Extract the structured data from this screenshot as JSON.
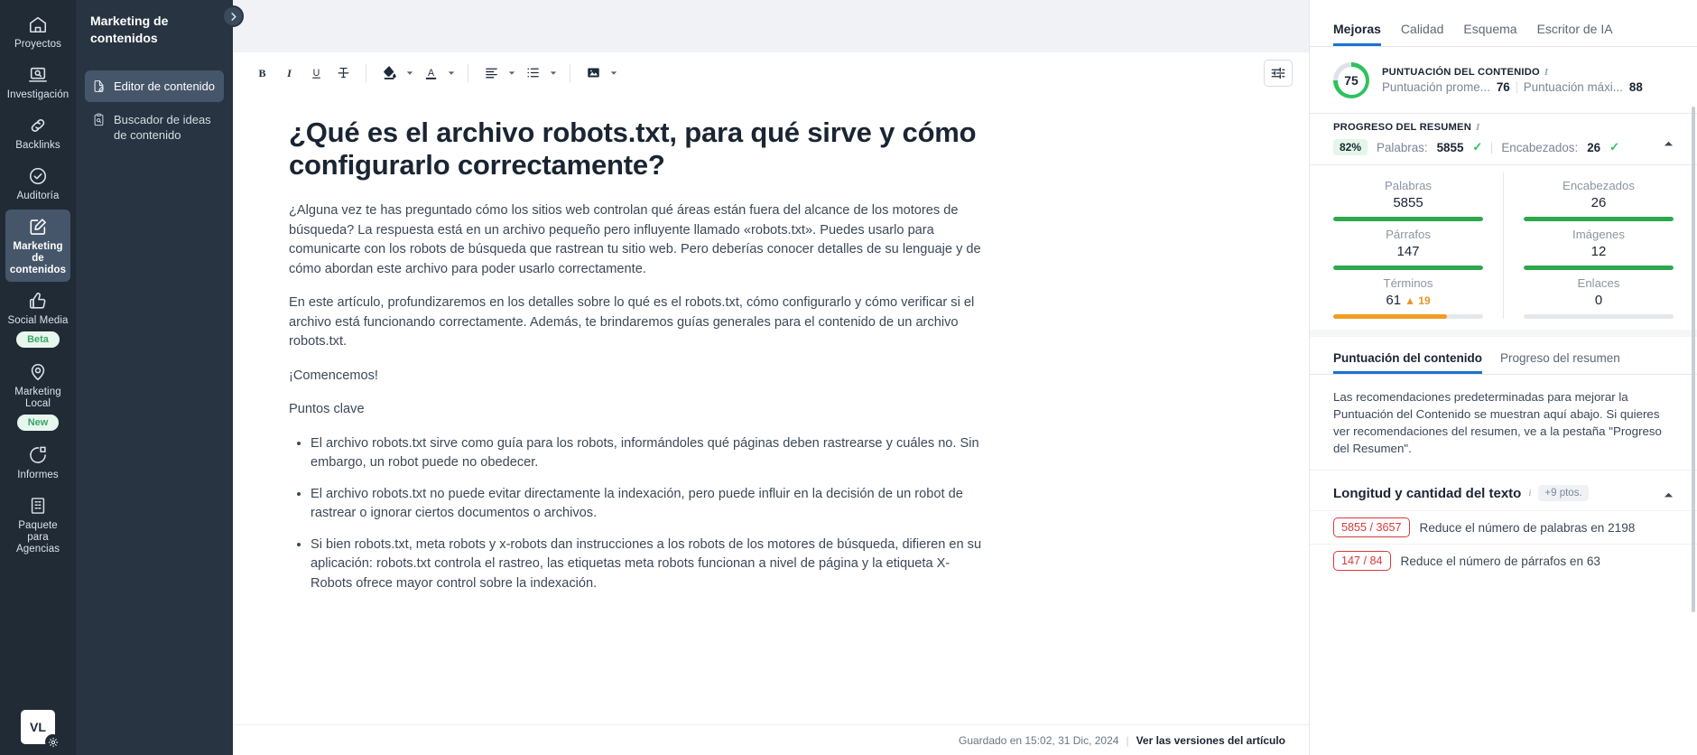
{
  "rail": {
    "items": [
      {
        "label": "Proyectos",
        "icon": "home-icon",
        "active": false,
        "badge": null
      },
      {
        "label": "Investigación",
        "icon": "research-icon",
        "active": false,
        "badge": null
      },
      {
        "label": "Backlinks",
        "icon": "link-icon",
        "active": false,
        "badge": null
      },
      {
        "label": "Auditoría",
        "icon": "check-circle-icon",
        "active": false,
        "badge": null
      },
      {
        "label": "Marketing de contenidos",
        "icon": "pencil-square-icon",
        "active": true,
        "badge": null
      },
      {
        "label": "Social Media",
        "icon": "thumbs-up-icon",
        "active": false,
        "badge": "Beta"
      },
      {
        "label": "Marketing Local",
        "icon": "map-pin-icon",
        "active": false,
        "badge": "New"
      },
      {
        "label": "Informes",
        "icon": "pie-chart-icon",
        "active": false,
        "badge": null
      },
      {
        "label": "Paquete para Agencias",
        "icon": "building-icon",
        "active": false,
        "badge": null
      }
    ],
    "avatar_initials": "VL"
  },
  "subnav": {
    "title": "Marketing de contenidos",
    "collapse_tooltip": "Expandir",
    "items": [
      {
        "label": "Editor de contenido",
        "icon": "document-pencil-icon",
        "active": true
      },
      {
        "label": "Buscador de ideas de contenido",
        "icon": "clipboard-search-icon",
        "active": false
      }
    ]
  },
  "toolbar": {
    "buttons": [
      {
        "name": "bold",
        "label": "B",
        "icon": "bold-icon",
        "caret": false
      },
      {
        "name": "italic",
        "label": "I",
        "icon": "italic-icon",
        "caret": false
      },
      {
        "name": "underline",
        "label": "U",
        "icon": "underline-icon",
        "caret": false
      },
      {
        "name": "strikethrough",
        "label": "T",
        "icon": "strikethrough-icon",
        "caret": false
      },
      {
        "name": "highlight-color",
        "label": "",
        "icon": "paint-bucket-icon",
        "caret": true
      },
      {
        "name": "text-color",
        "label": "A",
        "icon": "text-color-icon",
        "caret": true
      },
      {
        "name": "align",
        "label": "",
        "icon": "align-left-icon",
        "caret": true
      },
      {
        "name": "list",
        "label": "",
        "icon": "bulleted-list-icon",
        "caret": true
      },
      {
        "name": "image",
        "label": "",
        "icon": "image-icon",
        "caret": true
      }
    ],
    "settings_label": "Ajustes del editor"
  },
  "document": {
    "title": "¿Qué es el archivo robots.txt, para qué sirve y cómo configurarlo correctamente?",
    "paragraphs": [
      "¿Alguna vez te has preguntado cómo los sitios web controlan qué áreas están fuera del alcance de los motores de búsqueda? La respuesta está en un archivo pequeño pero influyente llamado «robots.txt». Puedes usarlo para comunicarte con los robots de búsqueda que rastrean tu sitio web. Pero deberías conocer detalles de su lenguaje y de cómo abordan este archivo para poder usarlo correctamente.",
      "En este artículo, profundizaremos en los detalles sobre lo qué es el robots.txt, cómo configurarlo y cómo verificar si el archivo está funcionando correctamente. Además, te brindaremos guías generales para el contenido de un archivo robots.txt.",
      "¡Comencemos!",
      "Puntos clave"
    ],
    "bullets": [
      "El archivo robots.txt sirve como guía para los robots, informándoles qué páginas deben rastrearse y cuáles no. Sin embargo, un robot puede no obedecer.",
      "El archivo robots.txt no puede evitar directamente la indexación, pero puede influir en la decisión de un robot de rastrear o ignorar ciertos documentos o archivos.",
      "Si bien robots.txt, meta robots y x-robots dan instrucciones a los robots de los motores de búsqueda, difieren en su aplicación: robots.txt controla el rastreo, las etiquetas meta robots funcionan a nivel de página y la etiqueta X-Robots ofrece mayor control sobre la indexación."
    ]
  },
  "statusbar": {
    "saved_text": "Guardado en 15:02, 31 Dic, 2024",
    "divider": "|",
    "versions_link": "Ver las versiones del artículo"
  },
  "right_panel": {
    "tabs": [
      {
        "label": "Mejoras",
        "active": true
      },
      {
        "label": "Calidad",
        "active": false
      },
      {
        "label": "Esquema",
        "active": false
      },
      {
        "label": "Escritor de IA",
        "active": false
      }
    ],
    "content_score": {
      "value": "75",
      "percent": 75,
      "caption": "PUNTUACIÓN DEL CONTENIDO",
      "info_icon": "info-icon",
      "average_label": "Puntuación prome...",
      "average_value": "76",
      "max_label": "Puntuación máxi...",
      "max_value": "88",
      "ring_color": "#2ec25e"
    },
    "summary_progress": {
      "caption": "PROGRESO DEL RESUMEN",
      "info_icon": "info-icon",
      "percent_badge": "82%",
      "words_label": "Palabras:",
      "words_value": "5855",
      "words_check": "✓",
      "headings_label": "Encabezados:",
      "headings_value": "26",
      "headings_check": "✓",
      "collapse_icon": "chevron-up-icon"
    },
    "metrics": [
      {
        "label": "Palabras",
        "value": "5855",
        "delta": null,
        "bar_percent": 100,
        "bar_color": "#2ea84f"
      },
      {
        "label": "Encabezados",
        "value": "26",
        "delta": null,
        "bar_percent": 100,
        "bar_color": "#2ea84f"
      },
      {
        "label": "Párrafos",
        "value": "147",
        "delta": null,
        "bar_percent": 100,
        "bar_color": "#2ea84f"
      },
      {
        "label": "Imágenes",
        "value": "12",
        "delta": null,
        "bar_percent": 100,
        "bar_color": "#2ea84f"
      },
      {
        "label": "Términos",
        "value": "61",
        "delta": "▲ 19",
        "bar_percent": 76,
        "bar_color": "#ef9e21"
      },
      {
        "label": "Enlaces",
        "value": "0",
        "delta": null,
        "bar_percent": 0,
        "bar_color": "#e4e7eb"
      }
    ],
    "subtabs": [
      {
        "label": "Puntuación del contenido",
        "active": true
      },
      {
        "label": "Progreso del resumen",
        "active": false
      }
    ],
    "note": "Las recomendaciones predeterminadas para mejorar la Puntuación del Contenido se muestran aquí abajo. Si quieres ver recomendaciones del resumen, ve a la pestaña \"Progreso del Resumen\".",
    "recommendations": {
      "title": "Longitud y cantidad del texto",
      "info_icon": "info-icon",
      "points_badge": "+9 ptos.",
      "collapse_icon": "chevron-up-icon",
      "rows": [
        {
          "pill": "5855 / 3657",
          "text": "Reduce el número de palabras en 2198"
        },
        {
          "pill": "147 / 84",
          "text": "Reduce el número de párrafos en 63"
        }
      ]
    }
  },
  "colors": {
    "accent": "#1a73cc",
    "green": "#2ec25e",
    "orange": "#ef9e21",
    "red": "#d93a3a",
    "rail_bg": "#212b36",
    "subnav_bg": "#283442"
  }
}
